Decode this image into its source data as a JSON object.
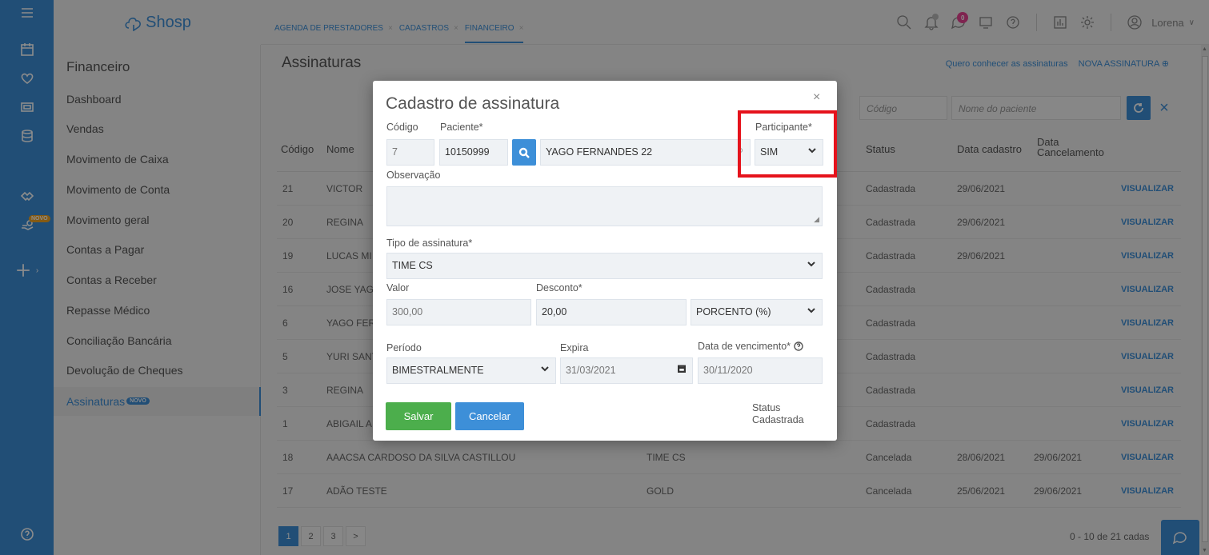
{
  "app": {
    "logo_text": "Shosp",
    "novo_badge": "NOVO"
  },
  "tabs": [
    {
      "label": "AGENDA DE PRESTADORES"
    },
    {
      "label": "CADASTROS"
    },
    {
      "label": "FINANCEIRO"
    }
  ],
  "header": {
    "notification_count": "0",
    "user_name": "Lorena"
  },
  "sidebar": {
    "title": "Financeiro",
    "items": [
      {
        "label": "Dashboard"
      },
      {
        "label": "Vendas"
      },
      {
        "label": "Movimento de Caixa"
      },
      {
        "label": "Movimento de Conta"
      },
      {
        "label": "Movimento geral"
      },
      {
        "label": "Contas a Pagar"
      },
      {
        "label": "Contas a Receber"
      },
      {
        "label": "Repasse Médico"
      },
      {
        "label": "Conciliação Bancária"
      },
      {
        "label": "Devolução de Cheques"
      },
      {
        "label": "Assinaturas",
        "badge": "NOVO"
      }
    ]
  },
  "page": {
    "title": "Assinaturas",
    "link_know": "Quero conhecer as assinaturas",
    "link_new": "NOVA ASSINATURA ⊕",
    "filter_code_placeholder": "Código",
    "filter_name_placeholder": "Nome do paciente"
  },
  "table": {
    "headers": {
      "codigo": "Código",
      "nome": "Nome",
      "status": "Status",
      "data_cadastro": "Data cadastro",
      "data_cancelamento": "Data Cancelamento"
    },
    "action_label": "VISUALIZAR",
    "rows": [
      {
        "codigo": "21",
        "nome": "VICTOR",
        "tipo": "",
        "status": "Cadastrada",
        "cadastro": "29/06/2021",
        "cancelamento": ""
      },
      {
        "codigo": "20",
        "nome": "REGINA",
        "tipo": "",
        "status": "Cadastrada",
        "cadastro": "29/06/2021",
        "cancelamento": ""
      },
      {
        "codigo": "19",
        "nome": "LUCAS MI",
        "tipo": "",
        "status": "Cadastrada",
        "cadastro": "29/06/2021",
        "cancelamento": ""
      },
      {
        "codigo": "16",
        "nome": "JOSE YAG",
        "tipo": "",
        "status": "Cadastrada",
        "cadastro": "",
        "cancelamento": ""
      },
      {
        "codigo": "6",
        "nome": "YAGO FER",
        "tipo": "",
        "status": "Cadastrada",
        "cadastro": "",
        "cancelamento": ""
      },
      {
        "codigo": "5",
        "nome": "YURI SANT",
        "tipo": "",
        "status": "Cadastrada",
        "cadastro": "",
        "cancelamento": ""
      },
      {
        "codigo": "3",
        "nome": "REGINA",
        "tipo": "",
        "status": "Cadastrada",
        "cadastro": "",
        "cancelamento": ""
      },
      {
        "codigo": "1",
        "nome": "ABIGAIL A",
        "tipo": "",
        "status": "Cadastrada",
        "cadastro": "",
        "cancelamento": ""
      },
      {
        "codigo": "18",
        "nome": "AAACSA CARDOSO DA SILVA CASTILLOU",
        "tipo": "TIME CS",
        "status": "Cancelada",
        "cadastro": "28/06/2021",
        "cancelamento": "29/06/2021"
      },
      {
        "codigo": "17",
        "nome": "ADÃO TESTE",
        "tipo": "GOLD",
        "status": "Cancelada",
        "cadastro": "25/06/2021",
        "cancelamento": "29/06/2021"
      }
    ]
  },
  "pagination": {
    "pages": [
      "1",
      "2",
      "3",
      ">"
    ],
    "count_label": "0 - 10 de 21 cadas"
  },
  "modal": {
    "title": "Cadastro de assinatura",
    "close": "×",
    "codigo_label": "Código",
    "codigo_value": "7",
    "paciente_label": "Paciente*",
    "paciente_id": "10150999",
    "paciente_name": "YAGO FERNANDES 22",
    "participante_label": "Participante*",
    "participante_value": "SIM",
    "observacao_label": "Observação",
    "tipo_label": "Tipo de assinatura*",
    "tipo_value": "TIME CS",
    "valor_label": "Valor",
    "valor_value": "300,00",
    "desconto_label": "Desconto*",
    "desconto_value": "20,00",
    "desconto_tipo": "PORCENTO (%)",
    "periodo_label": "Período",
    "periodo_value": "BIMESTRALMENTE",
    "expira_label": "Expira",
    "expira_value": "31/03/2021",
    "vencimento_label": "Data de vencimento*",
    "vencimento_value": "30/11/2020",
    "save_label": "Salvar",
    "cancel_label": "Cancelar",
    "status_label": "Status",
    "status_value": "Cadastrada"
  },
  "colors": {
    "primary": "#3d8fd8",
    "save": "#4cae4c",
    "highlight": "#e5131c",
    "notif": "#e84393"
  }
}
